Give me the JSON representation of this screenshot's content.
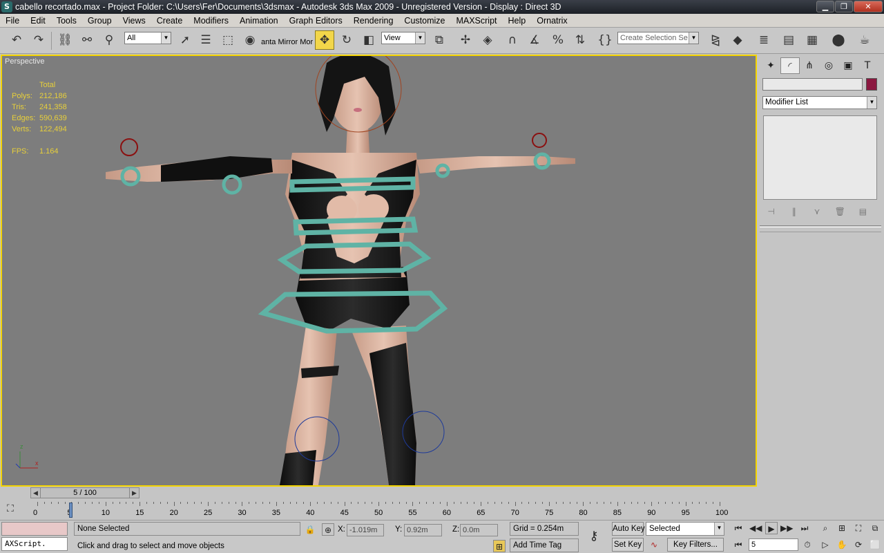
{
  "window": {
    "title": "cabello recortado.max     - Project Folder: C:\\Users\\Fer\\Documents\\3dsmax     - Autodesk 3ds Max  2009   - Unregistered Version      - Display : Direct 3D",
    "app_icon": "3ds-max-icon"
  },
  "menu": [
    "File",
    "Edit",
    "Tools",
    "Group",
    "Views",
    "Create",
    "Modifiers",
    "Animation",
    "Graph Editors",
    "Rendering",
    "Customize",
    "MAXScript",
    "Help",
    "Ornatrix"
  ],
  "toolbar": {
    "selection_filter": "All",
    "mirror_label": "anta Mirror Mor",
    "coord_system": "View",
    "named_selection_placeholder": "Create Selection Se"
  },
  "viewport": {
    "label": "Perspective",
    "stats": {
      "header": "Total",
      "rows": [
        {
          "label": "Polys:",
          "value": "212,186"
        },
        {
          "label": "Tris:",
          "value": "241,358"
        },
        {
          "label": "Edges:",
          "value": "590,639"
        },
        {
          "label": "Verts:",
          "value": "122,494"
        }
      ],
      "fps_label": "FPS:",
      "fps_value": "1.164"
    },
    "axis": {
      "z": "z",
      "x": "x"
    }
  },
  "command_panel": {
    "modifier_list": "Modifier List",
    "object_color": "#8b1840"
  },
  "time": {
    "slider_label": "5 / 100",
    "current_frame": 5,
    "ticks": [
      "0",
      "5",
      "10",
      "15",
      "20",
      "25",
      "30",
      "35",
      "40",
      "45",
      "50",
      "55",
      "60",
      "65",
      "70",
      "75",
      "80",
      "85",
      "90",
      "95",
      "100"
    ]
  },
  "status": {
    "maxscript": "AXScript.",
    "selection": "None Selected",
    "prompt": "Click and drag to select and move objects",
    "x_label": "X:",
    "x_value": "-1.019m",
    "y_label": "Y:",
    "y_value": "0.92m",
    "z_label": "Z:",
    "z_value": "0.0m",
    "grid": "Grid = 0.254m",
    "add_time_tag": "Add Time Tag",
    "auto_key": "Auto Key",
    "set_key": "Set Key",
    "key_mode": "Selected",
    "key_filters": "Key Filters...",
    "frame_field": "5"
  }
}
